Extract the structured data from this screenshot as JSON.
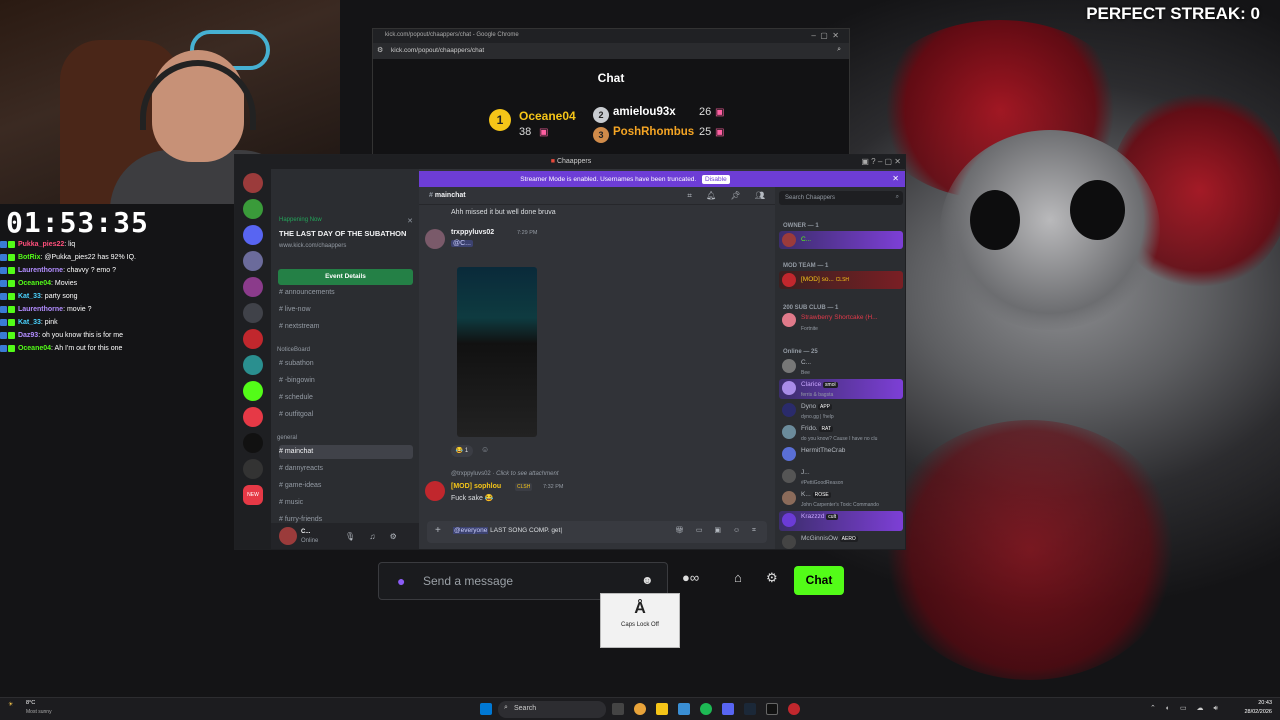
{
  "overlay": {
    "streak": "PERFECT STREAK: 0",
    "timer": "01:53:35",
    "chat": [
      {
        "user": "Pukka_pies22",
        "msg": ": liq",
        "color": "#ff4f7b"
      },
      {
        "user": "BotRix",
        "msg": ": @Pukka_pies22 has 92% IQ.",
        "color": "#53fc18"
      },
      {
        "user": "Laurenthorne",
        "msg": ": chavvy ? emo ?",
        "color": "#b28dff"
      },
      {
        "user": "Oceane04",
        "msg": ": Movies",
        "color": "#53fc18"
      },
      {
        "user": "Kat_33",
        "msg": ": party song",
        "color": "#4ad3ff"
      },
      {
        "user": "Laurenthorne",
        "msg": ": movie ?",
        "color": "#b28dff"
      },
      {
        "user": "Kat_33",
        "msg": ": pink",
        "color": "#4ad3ff"
      },
      {
        "user": "Daz93",
        "msg": ": oh you know this is for me",
        "color": "#b28dff"
      },
      {
        "user": "Oceane04",
        "msg": ": Ah I'm out for this one",
        "color": "#53fc18"
      }
    ]
  },
  "chrome": {
    "tab_title": "kick.com/popout/chaappers/chat - Google Chrome",
    "address": "kick.com/popout/chaappers/chat",
    "chat_title": "Chat",
    "podium": [
      {
        "rank": "1",
        "name": "Oceane04",
        "count": "38"
      },
      {
        "rank": "2",
        "name": "amielou93x",
        "count": "26"
      },
      {
        "rank": "3",
        "name": "PoshRhombus",
        "count": "25"
      }
    ]
  },
  "discord": {
    "window_title": "Chaappers",
    "streamer_banner": "Streamer Mode is enabled. Usernames have been truncated.",
    "disable_label": "Disable",
    "happening_now": "Happening Now",
    "event_title": "THE LAST DAY OF THE SUBATHON",
    "event_link": "www.kick.com/chaappers",
    "event_button": "Event Details",
    "channels_top": [
      "announcements",
      "live-now",
      "nextstream"
    ],
    "noticeboard_label": "NoticeBoard",
    "channels_notice": [
      "subathon",
      "-bingowin",
      "schedule",
      "outfitgoal"
    ],
    "general_label": "general",
    "channels_general": [
      "mainchat",
      "dannyreacts",
      "game-ideas",
      "music",
      "furry-friends"
    ],
    "user_name": "C...",
    "user_status": "Online",
    "header_channel": "mainchat",
    "search_placeholder": "Search Chaappers",
    "messages": {
      "m0_text": "Ahh missed it but well done bruva",
      "m1_author": "trxppyluvs02",
      "m1_time": "7:29 PM",
      "m1_mention": "@C...",
      "m1_reaction_count": "1",
      "m2_reply_name": "@trxppyluvs02",
      "m2_reply_text": "Click to see attachment",
      "m2_author": "[MOD] sophlou",
      "m2_badge": "CLSH",
      "m2_time": "7:32 PM",
      "m2_text": "Fuck sake 😂"
    },
    "compose_mention": "@everyone",
    "compose_text": " LAST SONG COMP. get",
    "members": {
      "owner_label": "OWNER — 1",
      "owner_name": "C...",
      "modteam_label": "MOD TEAM — 1",
      "mod_name": "[MOD] so...",
      "mod_badge": "CLSH",
      "sub_label": "200 SUB CLUB — 1",
      "sub_name": "Strawberry Shortcake (H...",
      "sub_status": "Fortnite",
      "online_label": "Online — 25",
      "online": [
        {
          "name": "C...",
          "status": "Bee",
          "color": "#b5bac1",
          "tag": ""
        },
        {
          "name": "Clarice",
          "status": "ferris & bagsta",
          "color": "#c9a7ff",
          "tag": "smol"
        },
        {
          "name": "Dyno",
          "status": "dyno.gg | !help",
          "color": "#b5bac1",
          "tag": "APP"
        },
        {
          "name": "Frido.",
          "status": "do you know? Cause I have no clu",
          "color": "#b5bac1",
          "tag": "RAT"
        },
        {
          "name": "HermitTheCrab",
          "status": "",
          "color": "#b5bac1",
          "tag": ""
        },
        {
          "name": "J...",
          "status": "#PettiGoodReason",
          "color": "#b5bac1",
          "tag": ""
        },
        {
          "name": "K...",
          "status": "John Carpenter's Toxic Commando",
          "color": "#b5bac1",
          "tag": "ROSE"
        },
        {
          "name": "Krazzzd",
          "status": "",
          "color": "#c9a7ff",
          "tag": "cult"
        },
        {
          "name": "McGinnisOw",
          "status": "",
          "color": "#b5bac1",
          "tag": "AERO"
        }
      ]
    }
  },
  "kick": {
    "placeholder": "Send a message",
    "chat_button": "Chat",
    "caps_lock": "Caps Lock Off"
  },
  "taskbar": {
    "weather_temp": "8°C",
    "weather_desc": "Most sunny",
    "search": "Search",
    "time": "20:43",
    "date": "28/02/2026"
  }
}
